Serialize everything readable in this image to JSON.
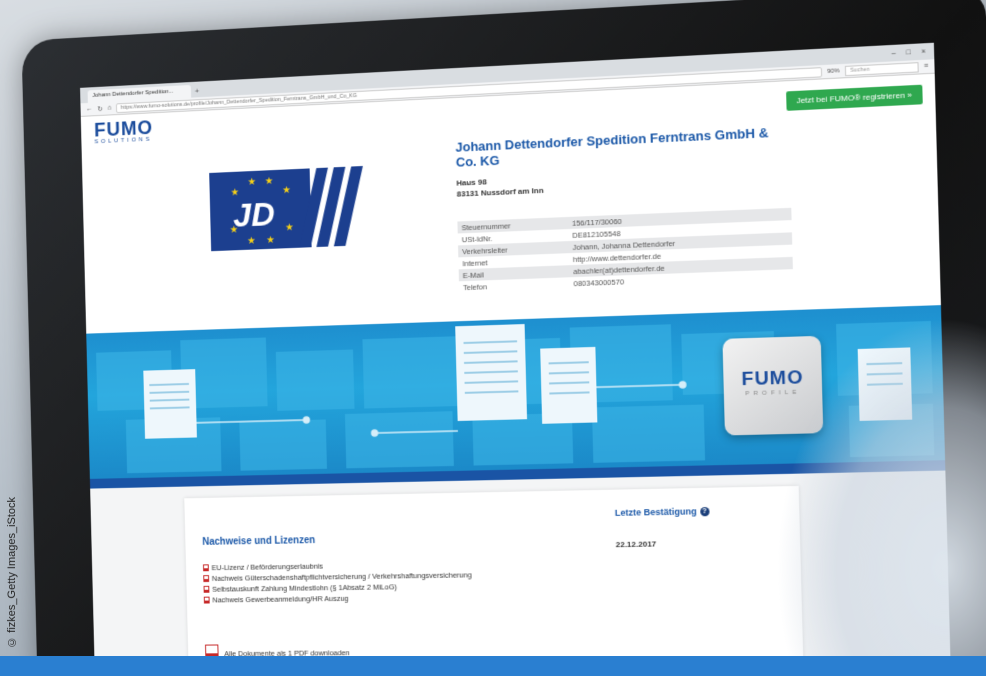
{
  "browser": {
    "tab_title": "Johann Dettendorfer Spedition...",
    "url": "https://www.fumo-solutions.de/profile/Johann_Dettendorfer_Spedition_Ferntrans_GmbH_und_Co_KG",
    "zoom": "90%",
    "search_placeholder": "Suchen",
    "new_tab_icon": "plus-icon"
  },
  "header": {
    "logo_main": "FUMO",
    "logo_sub": "SOLUTIONS",
    "register_button": "Jetzt bei FUMO® registrieren »"
  },
  "company": {
    "name": "Johann Dettendorfer Spedition Ferntrans GmbH & Co. KG",
    "address_line1": "Haus 98",
    "address_line2": "83131 Nussdorf am Inn",
    "logo_letters": "JD",
    "info_rows": [
      {
        "label": "Steuernummer",
        "value": "156/117/30060"
      },
      {
        "label": "USt-IdNr.",
        "value": "DE812105548"
      },
      {
        "label": "Verkehrsleiter",
        "value": "Johann, Johanna Dettendorfer"
      },
      {
        "label": "Internet",
        "value": "http://www.dettendorfer.de"
      },
      {
        "label": "E-Mail",
        "value": "abachler(at)dettendorfer.de"
      },
      {
        "label": "Telefon",
        "value": "080343000570"
      }
    ]
  },
  "banner": {
    "card_main": "FUMO",
    "card_sub": "PROFILE"
  },
  "documents": {
    "title": "Nachweise und Lizenzen",
    "confirm_label": "Letzte Bestätigung",
    "confirm_date": "22.12.2017",
    "items": [
      "EU-Lizenz / Beförderungserlaubnis",
      "Nachweis Güterschadenshaftpflichtversicherung / Verkehrshaftungsversicherung",
      "Selbstauskunft Zahlung Mindestlohn (§ 1Absatz 2 MiLoG)",
      "Nachweis Gewerbeanmeldung/HR Auszug"
    ],
    "download_label": "Alle Dokumente als 1 PDF downloaden"
  },
  "credit": "© fizkes_Getty Images_iStock",
  "colors": {
    "brand_blue": "#1b58a8",
    "register_green": "#2fa84f",
    "banner_blue": "#23a5dc",
    "pdf_red": "#c62828"
  }
}
